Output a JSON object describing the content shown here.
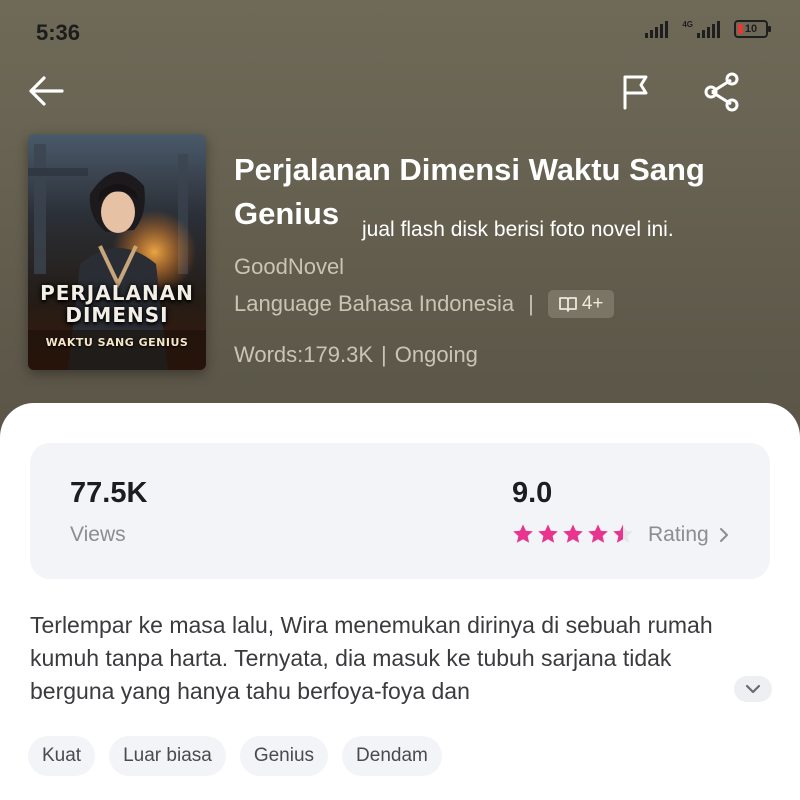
{
  "status_bar": {
    "time": "5:36",
    "network": "4G",
    "battery": "10"
  },
  "nav": {
    "back_icon": "arrow-left-icon",
    "report_icon": "flag-icon",
    "share_icon": "share-icon"
  },
  "book": {
    "title": "Perjalanan Dimensi Waktu Sang Genius",
    "overlay_note": "jual flash disk berisi foto novel ini.",
    "author": "GoodNovel",
    "language": "Language Bahasa Indonesia",
    "separator": "|",
    "age_rating": "4+",
    "words": "Words:179.3K",
    "status": "Ongoing",
    "cover_title": "PERJALANAN DIMENSI",
    "cover_subtitle": "WAKTU SANG GENIUS"
  },
  "stats": {
    "views_value": "77.5K",
    "views_label": "Views",
    "rating_value": "9.0",
    "rating_stars": 4.5,
    "rating_label": "Rating",
    "star_color": "#e8338f"
  },
  "synopsis": "Terlempar ke masa lalu, Wira menemukan dirinya di sebuah rumah kumuh tanpa harta. Ternyata, dia masuk ke tubuh sarjana tidak berguna yang hanya tahu berfoya-foya dan",
  "tags": [
    "Kuat",
    "Luar biasa",
    "Genius",
    "Dendam"
  ]
}
